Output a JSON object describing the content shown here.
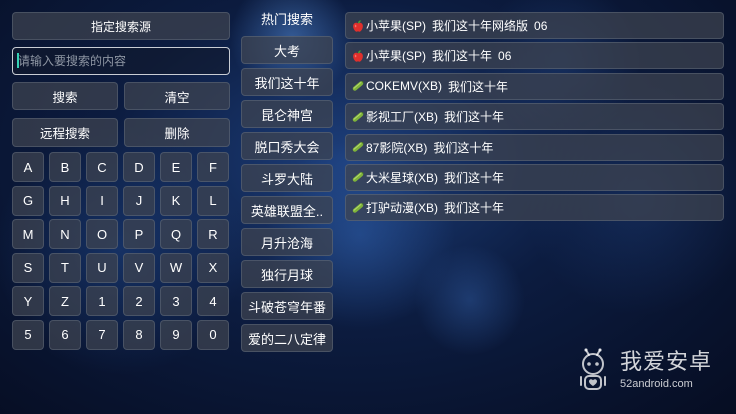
{
  "left_panel": {
    "source_button": "指定搜索源",
    "search_input": {
      "value": "",
      "placeholder": "请输入要搜索的内容"
    },
    "search_button": "搜索",
    "clear_button": "清空",
    "remote_search_button": "远程搜索",
    "delete_button": "删除",
    "keyboard": {
      "rows": [
        [
          "A",
          "B",
          "C",
          "D",
          "E",
          "F"
        ],
        [
          "G",
          "H",
          "I",
          "J",
          "K",
          "L"
        ],
        [
          "M",
          "N",
          "O",
          "P",
          "Q",
          "R"
        ],
        [
          "S",
          "T",
          "U",
          "V",
          "W",
          "X"
        ],
        [
          "Y",
          "Z",
          "1",
          "2",
          "3",
          "4"
        ],
        [
          "5",
          "6",
          "7",
          "8",
          "9",
          "0"
        ]
      ]
    }
  },
  "hot_search": {
    "title": "热门搜索",
    "items": [
      "大考",
      "我们这十年",
      "昆仑神宫",
      "脱口秀大会",
      "斗罗大陆",
      "英雄联盟全..",
      "月升沧海",
      "独行月球",
      "斗破苍穹年番",
      "爱的二八定律"
    ]
  },
  "results": [
    {
      "icon": "apple-icon",
      "source": "小苹果(SP)",
      "title": "我们这十年网络版",
      "episode": "06"
    },
    {
      "icon": "apple-icon",
      "source": "小苹果(SP)",
      "title": "我们这十年",
      "episode": "06"
    },
    {
      "icon": "cucumber-icon",
      "source": "COKEMV(XB)",
      "title": "我们这十年"
    },
    {
      "icon": "cucumber-icon",
      "source": "影视工厂(XB)",
      "title": "我们这十年"
    },
    {
      "icon": "cucumber-icon",
      "source": "87影院(XB)",
      "title": "我们这十年"
    },
    {
      "icon": "cucumber-icon",
      "source": "大米星球(XB)",
      "title": "我们这十年"
    },
    {
      "icon": "cucumber-icon",
      "source": "打驴动漫(XB)",
      "title": "我们这十年"
    }
  ],
  "watermark": {
    "icon": "android-robot-icon",
    "brand": "我爱安卓",
    "url": "52android.com"
  },
  "colors": {
    "background": "#0c1c40",
    "input_border": "#c9cdd4",
    "caret": "#35d0b5",
    "apple": "#e0302c",
    "cucumber": "#7fb33a"
  }
}
